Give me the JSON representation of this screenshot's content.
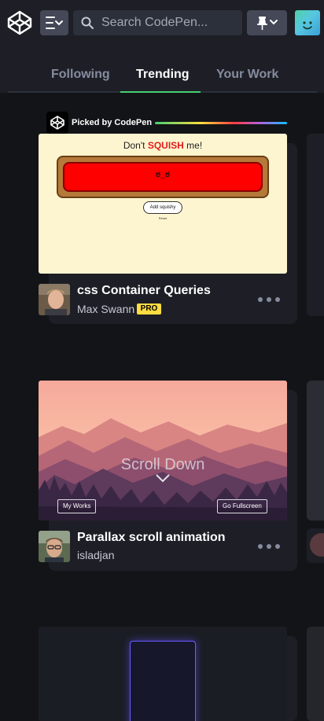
{
  "header": {
    "search_placeholder": "Search CodePen...",
    "accent_color": "#47cf73"
  },
  "tabs": [
    {
      "label": "Following",
      "active": false
    },
    {
      "label": "Trending",
      "active": true
    },
    {
      "label": "Your Work",
      "active": false
    }
  ],
  "picked": {
    "label": "Picked by CodePen"
  },
  "pens": [
    {
      "title": "css Container Queries",
      "author": "Max Swann",
      "badge": "PRO",
      "preview": {
        "heading_prefix": "Don't ",
        "heading_emph": "SQUISH",
        "heading_suffix": " me!",
        "face": "ಠ_ಠ",
        "button": "Add squishy",
        "reset": "Reset"
      }
    },
    {
      "title": "Parallax scroll animation",
      "author": "isladjan",
      "preview": {
        "overlay_text": "Scroll Down",
        "left_button": "My Works",
        "right_button": "Go Fullscreen"
      }
    }
  ]
}
